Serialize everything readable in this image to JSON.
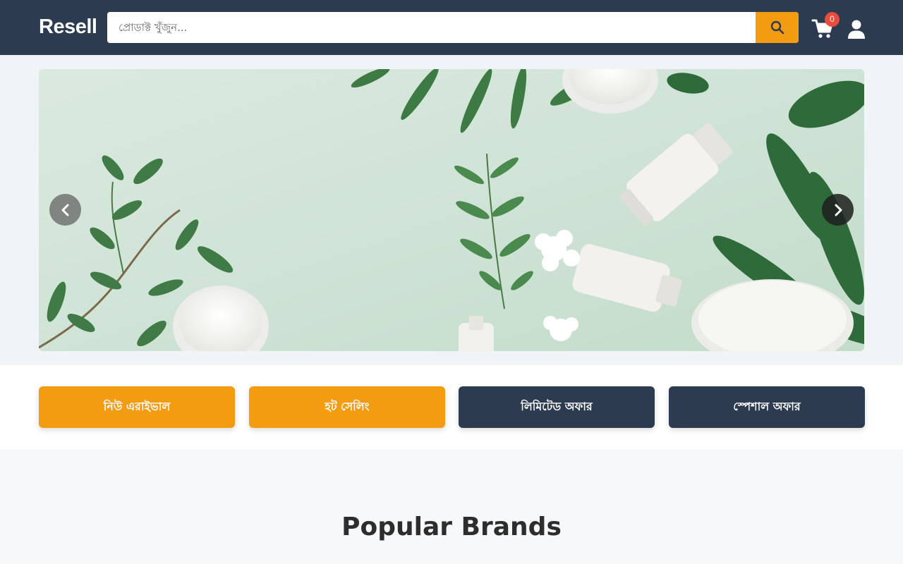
{
  "header": {
    "logo": "Resell",
    "search_placeholder": "প্রোডাক্ট খুঁজুন...",
    "search_icon": "search-icon",
    "cart_icon": "cart-icon",
    "cart_count": "0",
    "user_icon": "user-icon"
  },
  "hero": {
    "prev_icon": "chevron-left-icon",
    "next_icon": "chevron-right-icon"
  },
  "categories": [
    {
      "label": "নিউ এরাইভাল",
      "color": "#f39c12"
    },
    {
      "label": "হট সেলিং",
      "color": "#f39c12"
    },
    {
      "label": "লিমিটেড অফার",
      "color": "#2c3b50"
    },
    {
      "label": "স্পেশাল অফার",
      "color": "#2c3b50"
    }
  ],
  "brands": {
    "title": "Popular Brands"
  },
  "colors": {
    "header_bg": "#2c3b50",
    "accent": "#f39c12",
    "badge": "#e74c3c"
  }
}
